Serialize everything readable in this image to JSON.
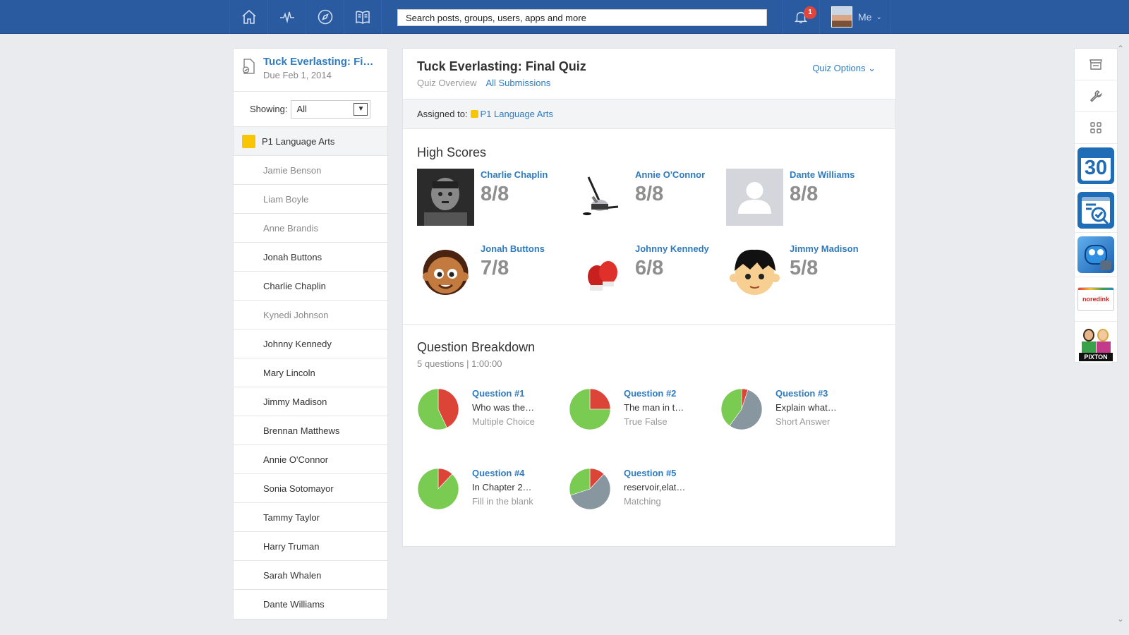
{
  "topbar": {
    "nav_icons": [
      "home-icon",
      "activity-icon",
      "compass-icon",
      "book-icon"
    ],
    "search_placeholder": "Search posts, groups, users, apps and more",
    "notifications_count": "1",
    "me_label": "Me"
  },
  "left": {
    "title": "Tuck Everlasting: Fi…",
    "due": "Due Feb 1, 2014",
    "showing_label": "Showing:",
    "showing_value": "All",
    "section": "P1 Language Arts",
    "students": [
      {
        "name": "Jamie Benson",
        "muted": true
      },
      {
        "name": "Liam Boyle",
        "muted": true
      },
      {
        "name": "Anne Brandis",
        "muted": true
      },
      {
        "name": "Jonah Buttons",
        "muted": false
      },
      {
        "name": "Charlie Chaplin",
        "muted": false
      },
      {
        "name": "Kynedi Johnson",
        "muted": true
      },
      {
        "name": "Johnny Kennedy",
        "muted": false
      },
      {
        "name": "Mary Lincoln",
        "muted": false
      },
      {
        "name": "Jimmy Madison",
        "muted": false
      },
      {
        "name": "Brennan Matthews",
        "muted": false
      },
      {
        "name": "Annie O'Connor",
        "muted": false
      },
      {
        "name": "Sonia Sotomayor",
        "muted": false
      },
      {
        "name": "Tammy Taylor",
        "muted": false
      },
      {
        "name": "Harry Truman",
        "muted": false
      },
      {
        "name": "Sarah Whalen",
        "muted": false
      },
      {
        "name": "Dante Williams",
        "muted": false
      }
    ]
  },
  "main": {
    "title": "Tuck Everlasting: Final Quiz",
    "tab_overview": "Quiz Overview",
    "tab_submissions": "All Submissions",
    "quiz_options": "Quiz Options",
    "assigned_label": "Assigned to:",
    "assigned_value": "P1 Language Arts",
    "high_scores_title": "High Scores",
    "high_scores": [
      {
        "name": "Charlie Chaplin",
        "score": "8/8",
        "pic": "photo"
      },
      {
        "name": "Annie O'Connor",
        "score": "8/8",
        "pic": "hockey"
      },
      {
        "name": "Dante Williams",
        "score": "8/8",
        "pic": "placeholder"
      },
      {
        "name": "Jonah Buttons",
        "score": "7/8",
        "pic": "boy-curly"
      },
      {
        "name": "Johnny Kennedy",
        "score": "6/8",
        "pic": "boxing"
      },
      {
        "name": "Jimmy Madison",
        "score": "5/8",
        "pic": "boy-black-hair"
      }
    ],
    "breakdown_title": "Question Breakdown",
    "breakdown_sub": "5 questions | 1:00:00",
    "questions": [
      {
        "label": "Question #1",
        "text": "Who was the…",
        "kind": "Multiple Choice",
        "correct": 0.57,
        "incorrect": 0.43,
        "ungraded": 0
      },
      {
        "label": "Question #2",
        "text": "The man in t…",
        "kind": "True False",
        "correct": 0.75,
        "incorrect": 0.25,
        "ungraded": 0
      },
      {
        "label": "Question #3",
        "text": "Explain what…",
        "kind": "Short Answer",
        "correct": 0.4,
        "incorrect": 0.05,
        "ungraded": 0.55
      },
      {
        "label": "Question #4",
        "text": "In Chapter 2…",
        "kind": "Fill in the blank",
        "correct": 0.88,
        "incorrect": 0.12,
        "ungraded": 0
      },
      {
        "label": "Question #5",
        "text": "reservoir,elat…",
        "kind": "Matching",
        "correct": 0.3,
        "incorrect": 0.12,
        "ungraded": 0.58
      }
    ],
    "colors": {
      "correct": "#7acb52",
      "incorrect": "#dc4437",
      "ungraded": "#8896a0"
    }
  },
  "apps": {
    "small": [
      "store-icon",
      "wrench-icon",
      "grid-icon"
    ],
    "calendar_day": "30",
    "noredlink_label": "noredink",
    "pixton_label": "PIXTON"
  }
}
